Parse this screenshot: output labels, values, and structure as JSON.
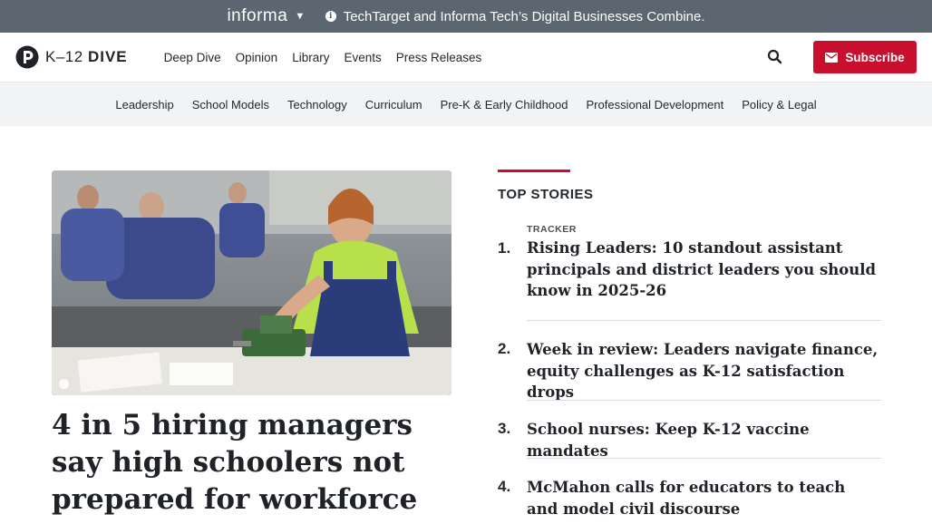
{
  "banner": {
    "brand": "informa",
    "notice": "TechTarget and Informa Tech’s Digital Businesses Combine."
  },
  "site": {
    "logo_prefix": "K–12",
    "logo_suffix": "DIVE"
  },
  "nav": {
    "items": [
      "Deep Dive",
      "Opinion",
      "Library",
      "Events",
      "Press Releases"
    ],
    "subscribe_label": "Subscribe"
  },
  "topics": [
    "Leadership",
    "School Models",
    "Technology",
    "Curriculum",
    "Pre-K & Early Childhood",
    "Professional Development",
    "Policy & Legal"
  ],
  "hero": {
    "headline": "4 in 5 hiring managers say high schoolers not prepared for workforce"
  },
  "top_stories": {
    "heading": "TOP STORIES",
    "items": [
      {
        "num": "1.",
        "tag": "TRACKER",
        "title": "Rising Leaders: 10 standout assistant principals and district leaders you should know in 2025-26"
      },
      {
        "num": "2.",
        "tag": "",
        "title": "Week in review: Leaders navigate finance, equity challenges as K-12 satisfaction drops"
      },
      {
        "num": "3.",
        "tag": "",
        "title": "School nurses: Keep K-12 vaccine mandates"
      },
      {
        "num": "4.",
        "tag": "",
        "title": "McMahon calls for educators to teach and model civil discourse"
      }
    ]
  },
  "colors": {
    "accent": "#c8102e",
    "banner_bg": "#5b6670",
    "topic_bg": "#f2f3f5"
  }
}
